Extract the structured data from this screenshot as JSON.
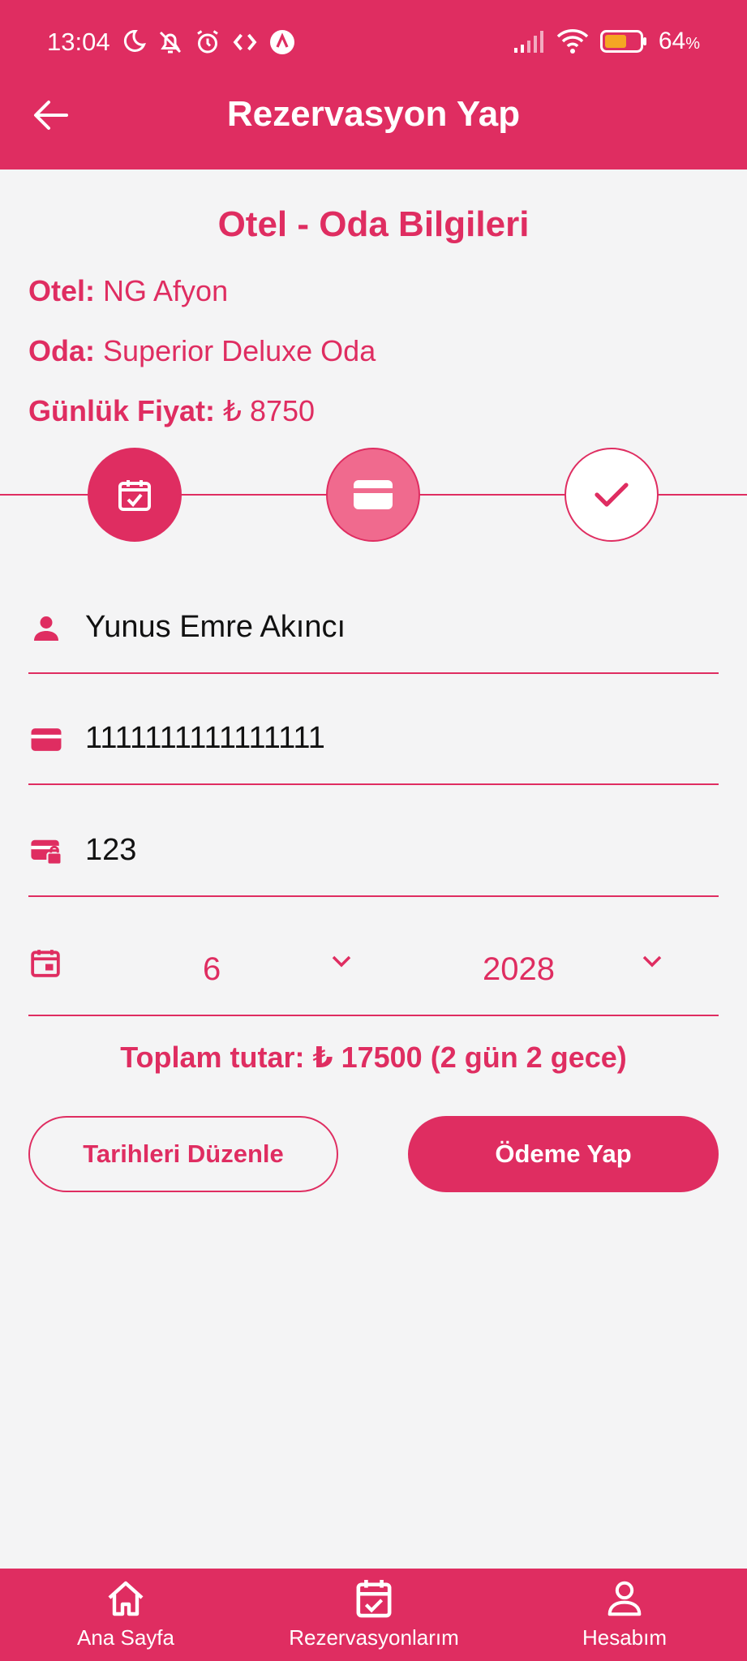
{
  "status_bar": {
    "time": "13:04",
    "battery_percent": "64",
    "battery_unit": "%"
  },
  "app_bar": {
    "title": "Rezervasyon Yap"
  },
  "hotel_info": {
    "section_title": "Otel - Oda Bilgileri",
    "hotel_label": "Otel:",
    "hotel_value": "NG Afyon",
    "room_label": "Oda:",
    "room_value": "Superior Deluxe Oda",
    "price_label": "Günlük Fiyat:",
    "price_value": "₺ 8750"
  },
  "stepper": {
    "steps": [
      {
        "icon": "calendar-check-icon",
        "state": "completed"
      },
      {
        "icon": "credit-card-icon",
        "state": "active"
      },
      {
        "icon": "check-icon",
        "state": "pending"
      }
    ]
  },
  "form": {
    "name_value": "Yunus Emre Akıncı",
    "card_number_value": "1111111111111111",
    "cvv_value": "123",
    "expiry_month": "6",
    "expiry_year": "2028"
  },
  "summary": {
    "total_text": "Toplam tutar: ₺ 17500 (2 gün 2 gece)"
  },
  "actions": {
    "edit_dates_label": "Tarihleri Düzenle",
    "pay_label": "Ödeme Yap"
  },
  "bottom_nav": {
    "items": [
      {
        "label": "Ana Sayfa",
        "icon": "home-icon"
      },
      {
        "label": "Rezervasyonlarım",
        "icon": "calendar-check-icon"
      },
      {
        "label": "Hesabım",
        "icon": "person-icon"
      }
    ]
  },
  "colors": {
    "primary": "#DF2D61",
    "primary_light": "#F06A8E",
    "background": "#F4F4F5"
  }
}
